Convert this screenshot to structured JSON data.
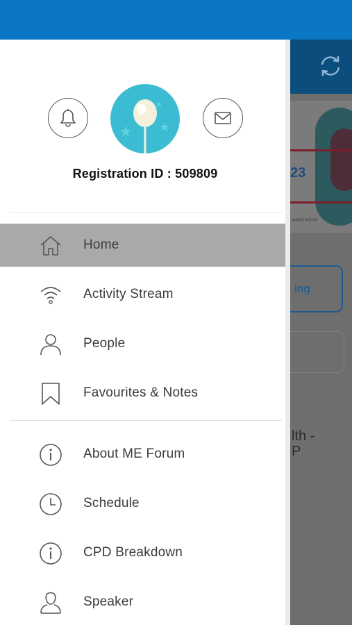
{
  "header": {
    "registration_label": "Registration ID : 509809"
  },
  "drawer": {
    "top_icons": [
      "bell-icon",
      "mail-icon"
    ],
    "menu_primary": [
      {
        "label": "Home",
        "icon": "home-icon",
        "active": true
      },
      {
        "label": "Activity Stream",
        "icon": "wifi-icon",
        "active": false
      },
      {
        "label": "People",
        "icon": "person-icon",
        "active": false
      },
      {
        "label": "Favourites & Notes",
        "icon": "bookmark-icon",
        "active": false
      }
    ],
    "menu_secondary": [
      {
        "label": "About ME Forum",
        "icon": "info-icon"
      },
      {
        "label": "Schedule",
        "icon": "clock-icon"
      },
      {
        "label": "CPD Breakdown",
        "icon": "info-icon"
      },
      {
        "label": "Speaker",
        "icon": "speaker-person-icon"
      }
    ]
  },
  "background": {
    "banner_text": "23",
    "banner_small": "quality actions",
    "button_fragment": "ing",
    "card_text_line1": "lth -",
    "card_text_line2": "P"
  },
  "colors": {
    "status_bar": "#0a76c4",
    "avatar_bg": "#3cbcd2",
    "active_item": "#a9a9a9"
  }
}
